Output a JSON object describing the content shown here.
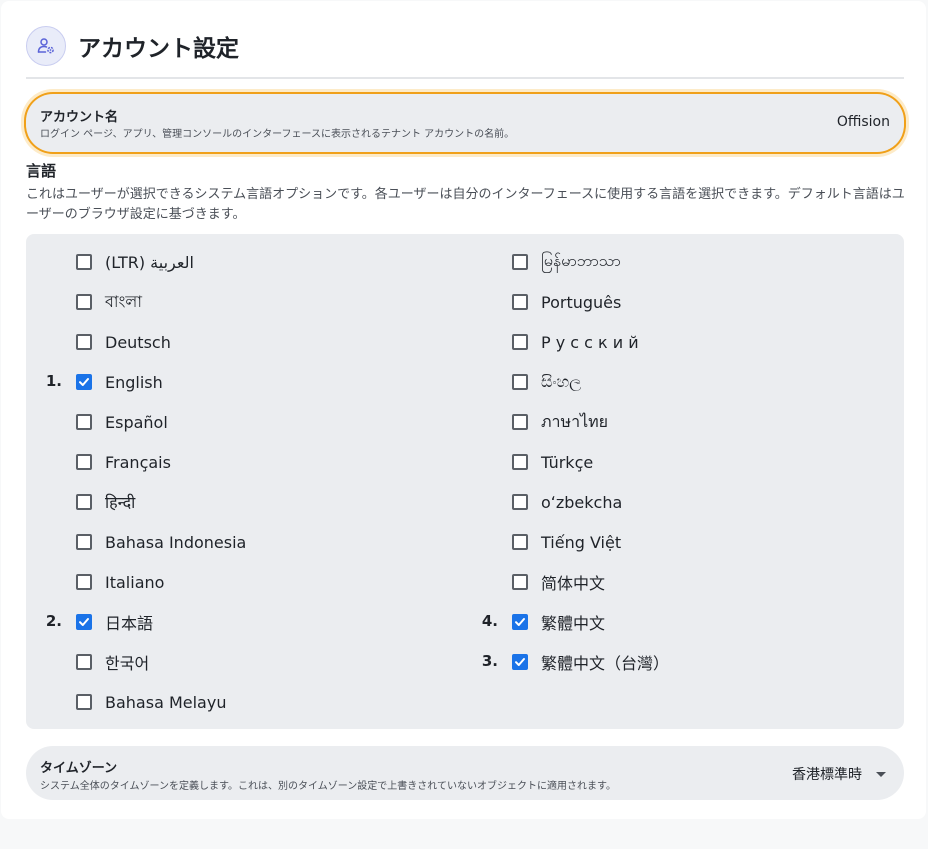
{
  "page": {
    "title": "アカウント設定"
  },
  "account": {
    "label": "アカウント名",
    "description": "ログイン ページ、アプリ、管理コンソールのインターフェースに表示されるテナント アカウントの名前。",
    "value": "Offision"
  },
  "language": {
    "title": "言語",
    "description": "これはユーザーが選択できるシステム言語オプションです。各ユーザーは自分のインターフェースに使用する言語を選択できます。デフォルト言語はユーザーのブラウザ設定に基づきます。",
    "options": [
      {
        "label": "(LTR) العربية",
        "checked": false,
        "order": ""
      },
      {
        "label": "বাংলা",
        "checked": false,
        "order": ""
      },
      {
        "label": "Deutsch",
        "checked": false,
        "order": ""
      },
      {
        "label": "English",
        "checked": true,
        "order": "1."
      },
      {
        "label": "Español",
        "checked": false,
        "order": ""
      },
      {
        "label": "Français",
        "checked": false,
        "order": ""
      },
      {
        "label": "हिन्दी",
        "checked": false,
        "order": ""
      },
      {
        "label": "Bahasa Indonesia",
        "checked": false,
        "order": ""
      },
      {
        "label": "Italiano",
        "checked": false,
        "order": ""
      },
      {
        "label": "日本語",
        "checked": true,
        "order": "2."
      },
      {
        "label": "한국어",
        "checked": false,
        "order": ""
      },
      {
        "label": "Bahasa Melayu",
        "checked": false,
        "order": ""
      },
      {
        "label": "မြန်မာဘာသာ",
        "checked": false,
        "order": ""
      },
      {
        "label": "Português",
        "checked": false,
        "order": ""
      },
      {
        "label": "Р у с с к и й",
        "checked": false,
        "order": ""
      },
      {
        "label": "සිංහල",
        "checked": false,
        "order": ""
      },
      {
        "label": "ภาษาไทย",
        "checked": false,
        "order": ""
      },
      {
        "label": "Türkçe",
        "checked": false,
        "order": ""
      },
      {
        "label": "oʻzbekcha",
        "checked": false,
        "order": ""
      },
      {
        "label": "Tiếng Việt",
        "checked": false,
        "order": ""
      },
      {
        "label": "简体中文",
        "checked": false,
        "order": ""
      },
      {
        "label": "繁體中文",
        "checked": true,
        "order": "4."
      },
      {
        "label": "繁體中文（台灣）",
        "checked": true,
        "order": "3."
      }
    ]
  },
  "timezone": {
    "label": "タイムゾーン",
    "description": "システム全体のタイムゾーンを定義します。これは、別のタイムゾーン設定で上書きされていないオブジェクトに適用されます。",
    "value": "香港標準時"
  },
  "icons": {
    "header": "user-gear-icon",
    "dropdown": "chevron-down-icon",
    "check": "check-icon"
  },
  "colors": {
    "accent": "#1a73e8",
    "highlight": "#f0a019",
    "panel": "#ebedf0"
  }
}
